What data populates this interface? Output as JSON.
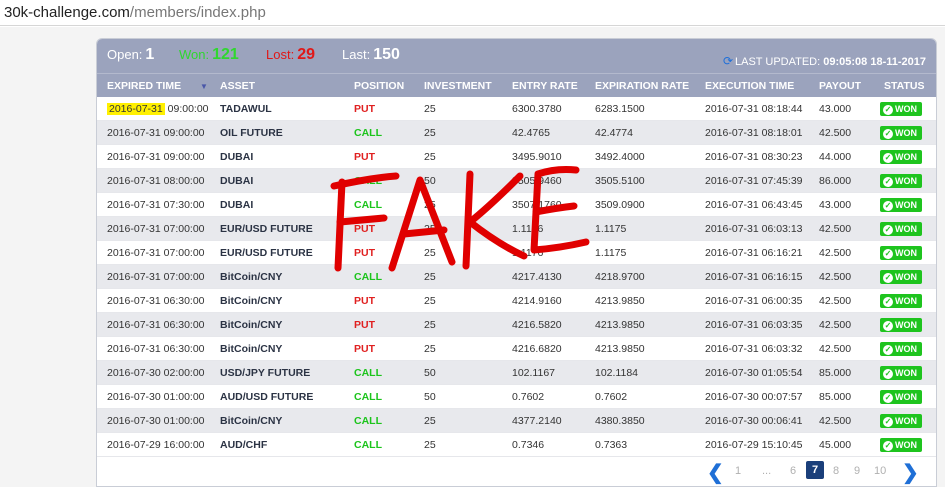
{
  "browser": {
    "url_host": "30k-challenge.com",
    "url_path": "/members/index.php"
  },
  "stats": {
    "open_label": "Open:",
    "open_value": "1",
    "won_label": "Won:",
    "won_value": "121",
    "lost_label": "Lost:",
    "lost_value": "29",
    "last_label": "Last:",
    "last_value": "150"
  },
  "updated": {
    "label": "LAST UPDATED:",
    "value": "09:05:08 18-11-2017"
  },
  "columns": {
    "expired_time": "EXPIRED TIME",
    "asset": "ASSET",
    "position": "POSITION",
    "investment": "INVESTMENT",
    "entry_rate": "ENTRY RATE",
    "expiration_rate": "EXPIRATION RATE",
    "execution_time": "EXECUTION TIME",
    "payout": "PAYOUT",
    "status": "STATUS"
  },
  "rows": [
    {
      "date": "2016-07-31",
      "time": "09:00:00",
      "asset": "TADAWUL",
      "position": "PUT",
      "investment": "25",
      "entry": "6300.3780",
      "expiration": "6283.1500",
      "execution": "2016-07-31 08:18:44",
      "payout": "43.000",
      "status": "WON"
    },
    {
      "date": "2016-07-31",
      "time": "09:00:00",
      "asset": "OIL FUTURE",
      "position": "CALL",
      "investment": "25",
      "entry": "42.4765",
      "expiration": "42.4774",
      "execution": "2016-07-31 08:18:01",
      "payout": "42.500",
      "status": "WON"
    },
    {
      "date": "2016-07-31",
      "time": "09:00:00",
      "asset": "DUBAI",
      "position": "PUT",
      "investment": "25",
      "entry": "3495.9010",
      "expiration": "3492.4000",
      "execution": "2016-07-31 08:30:23",
      "payout": "44.000",
      "status": "WON"
    },
    {
      "date": "2016-07-31",
      "time": "08:00:00",
      "asset": "DUBAI",
      "position": "CALL",
      "investment": "50",
      "entry": "3505.9460",
      "expiration": "3505.5100",
      "execution": "2016-07-31 07:45:39",
      "payout": "86.000",
      "status": "WON"
    },
    {
      "date": "2016-07-31",
      "time": "07:30:00",
      "asset": "DUBAI",
      "position": "CALL",
      "investment": "25",
      "entry": "3507.1760",
      "expiration": "3509.0900",
      "execution": "2016-07-31 06:43:45",
      "payout": "43.000",
      "status": "WON"
    },
    {
      "date": "2016-07-31",
      "time": "07:00:00",
      "asset": "EUR/USD FUTURE",
      "position": "PUT",
      "investment": "25",
      "entry": "1.1176",
      "expiration": "1.1175",
      "execution": "2016-07-31 06:03:13",
      "payout": "42.500",
      "status": "WON"
    },
    {
      "date": "2016-07-31",
      "time": "07:00:00",
      "asset": "EUR/USD FUTURE",
      "position": "PUT",
      "investment": "25",
      "entry": "1.1176",
      "expiration": "1.1175",
      "execution": "2016-07-31 06:16:21",
      "payout": "42.500",
      "status": "WON"
    },
    {
      "date": "2016-07-31",
      "time": "07:00:00",
      "asset": "BitCoin/CNY",
      "position": "CALL",
      "investment": "25",
      "entry": "4217.4130",
      "expiration": "4218.9700",
      "execution": "2016-07-31 06:16:15",
      "payout": "42.500",
      "status": "WON"
    },
    {
      "date": "2016-07-31",
      "time": "06:30:00",
      "asset": "BitCoin/CNY",
      "position": "PUT",
      "investment": "25",
      "entry": "4214.9160",
      "expiration": "4213.9850",
      "execution": "2016-07-31 06:00:35",
      "payout": "42.500",
      "status": "WON"
    },
    {
      "date": "2016-07-31",
      "time": "06:30:00",
      "asset": "BitCoin/CNY",
      "position": "PUT",
      "investment": "25",
      "entry": "4216.5820",
      "expiration": "4213.9850",
      "execution": "2016-07-31 06:03:35",
      "payout": "42.500",
      "status": "WON"
    },
    {
      "date": "2016-07-31",
      "time": "06:30:00",
      "asset": "BitCoin/CNY",
      "position": "PUT",
      "investment": "25",
      "entry": "4216.6820",
      "expiration": "4213.9850",
      "execution": "2016-07-31 06:03:32",
      "payout": "42.500",
      "status": "WON"
    },
    {
      "date": "2016-07-30",
      "time": "02:00:00",
      "asset": "USD/JPY FUTURE",
      "position": "CALL",
      "investment": "50",
      "entry": "102.1167",
      "expiration": "102.1184",
      "execution": "2016-07-30 01:05:54",
      "payout": "85.000",
      "status": "WON"
    },
    {
      "date": "2016-07-30",
      "time": "01:00:00",
      "asset": "AUD/USD FUTURE",
      "position": "CALL",
      "investment": "50",
      "entry": "0.7602",
      "expiration": "0.7602",
      "execution": "2016-07-30 00:07:57",
      "payout": "85.000",
      "status": "WON"
    },
    {
      "date": "2016-07-30",
      "time": "01:00:00",
      "asset": "BitCoin/CNY",
      "position": "CALL",
      "investment": "25",
      "entry": "4377.2140",
      "expiration": "4380.3850",
      "execution": "2016-07-30 00:06:41",
      "payout": "42.500",
      "status": "WON"
    },
    {
      "date": "2016-07-29",
      "time": "16:00:00",
      "asset": "AUD/CHF",
      "position": "CALL",
      "investment": "25",
      "entry": "0.7346",
      "expiration": "0.7363",
      "execution": "2016-07-29 15:10:45",
      "payout": "45.000",
      "status": "WON"
    }
  ],
  "pager": {
    "pages": [
      "1",
      "...",
      "6",
      "7",
      "8",
      "9",
      "10"
    ],
    "active": "7"
  },
  "overlay": {
    "text": "FAKE",
    "color": "#e00000"
  }
}
